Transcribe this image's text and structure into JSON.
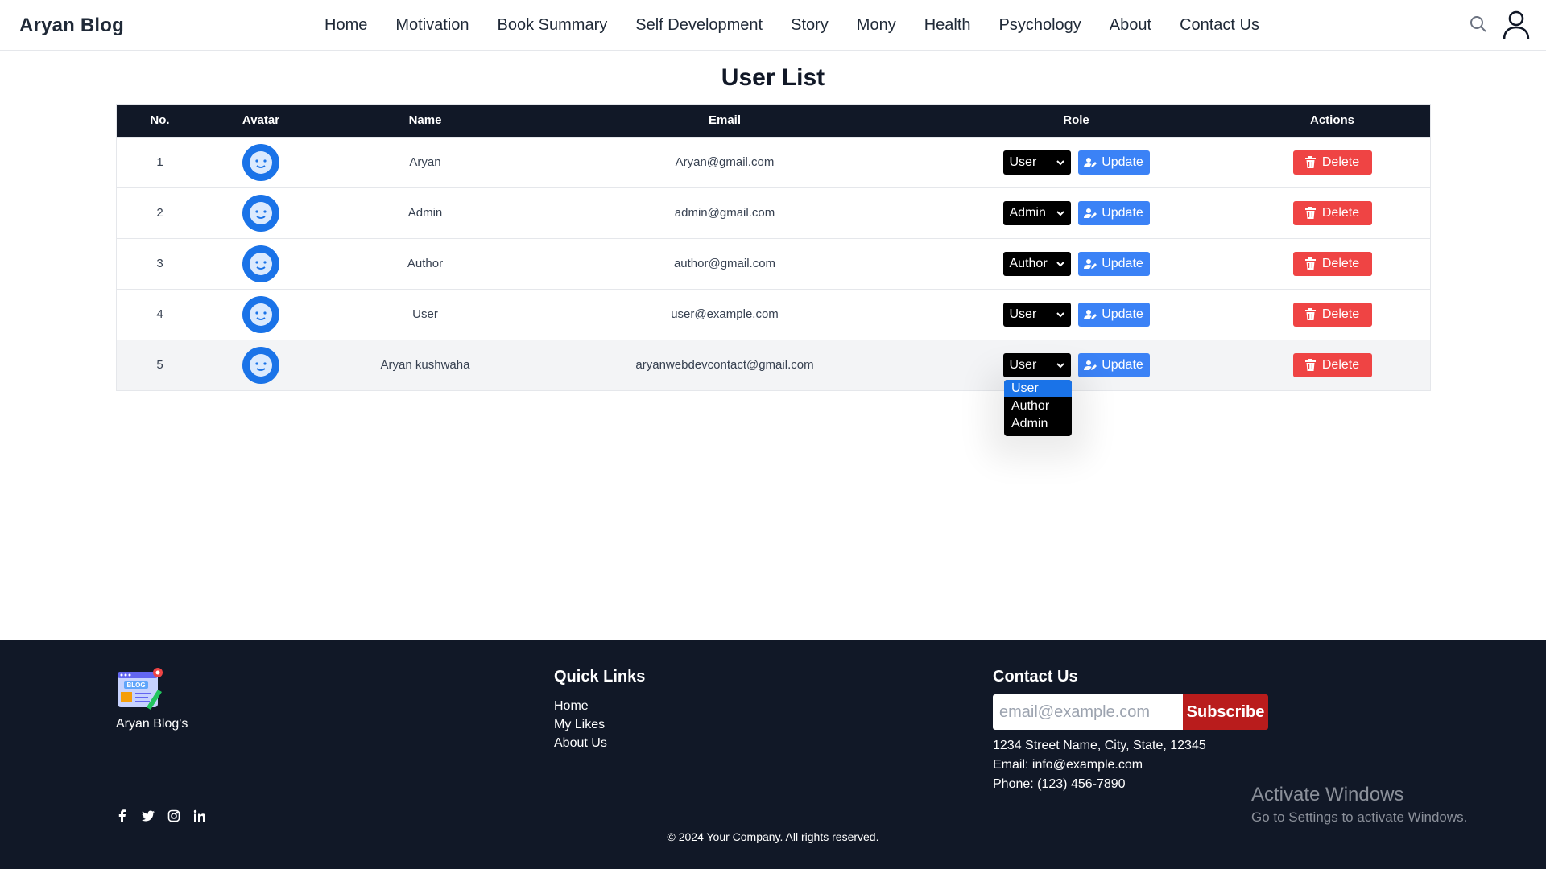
{
  "navbar": {
    "brand": "Aryan Blog",
    "links": [
      "Home",
      "Motivation",
      "Book Summary",
      "Self Development",
      "Story",
      "Mony",
      "Health",
      "Psychology",
      "About",
      "Contact Us"
    ],
    "search_icon": "search-icon",
    "user_icon": "user-icon"
  },
  "main": {
    "title": "User List",
    "headers": [
      "No.",
      "Avatar",
      "Name",
      "Email",
      "Role",
      "Actions"
    ],
    "update_label": "Update",
    "delete_label": "Delete",
    "rows": [
      {
        "no": "1",
        "name": "Aryan",
        "email": "Aryan@gmail.com",
        "role": "User"
      },
      {
        "no": "2",
        "name": "Admin",
        "email": "admin@gmail.com",
        "role": "Admin"
      },
      {
        "no": "3",
        "name": "Author",
        "email": "author@gmail.com",
        "role": "Author"
      },
      {
        "no": "4",
        "name": "User",
        "email": "user@example.com",
        "role": "User"
      },
      {
        "no": "5",
        "name": "Aryan kushwaha",
        "email": "aryanwebdevcontact@gmail.com",
        "role": "User"
      }
    ],
    "role_options": [
      "User",
      "Author",
      "Admin"
    ],
    "selected_option": "User"
  },
  "footer": {
    "logo_text": "Aryan Blog's",
    "logo_lettering": "BLOG",
    "quick_links_title": "Quick Links",
    "quick_links": [
      "Home",
      "My Likes",
      "About Us"
    ],
    "contact_title": "Contact Us",
    "email_placeholder": "email@example.com",
    "subscribe_label": "Subscribe",
    "address": "1234 Street Name, City, State, 12345",
    "email_line": "Email: info@example.com",
    "phone_line": "Phone: (123) 456-7890",
    "copyright": "© 2024 Your Company. All rights reserved.",
    "social_icons": [
      "facebook-icon",
      "twitter-icon",
      "instagram-icon",
      "linkedin-icon"
    ]
  },
  "watermark": {
    "title": "Activate Windows",
    "subtitle": "Go to Settings to activate Windows."
  },
  "colors": {
    "header_bg": "#111827",
    "update_blue": "#3b82f6",
    "delete_red": "#ef4444",
    "subscribe_red": "#b91c1c",
    "avatar_blue": "#1a73e8"
  }
}
